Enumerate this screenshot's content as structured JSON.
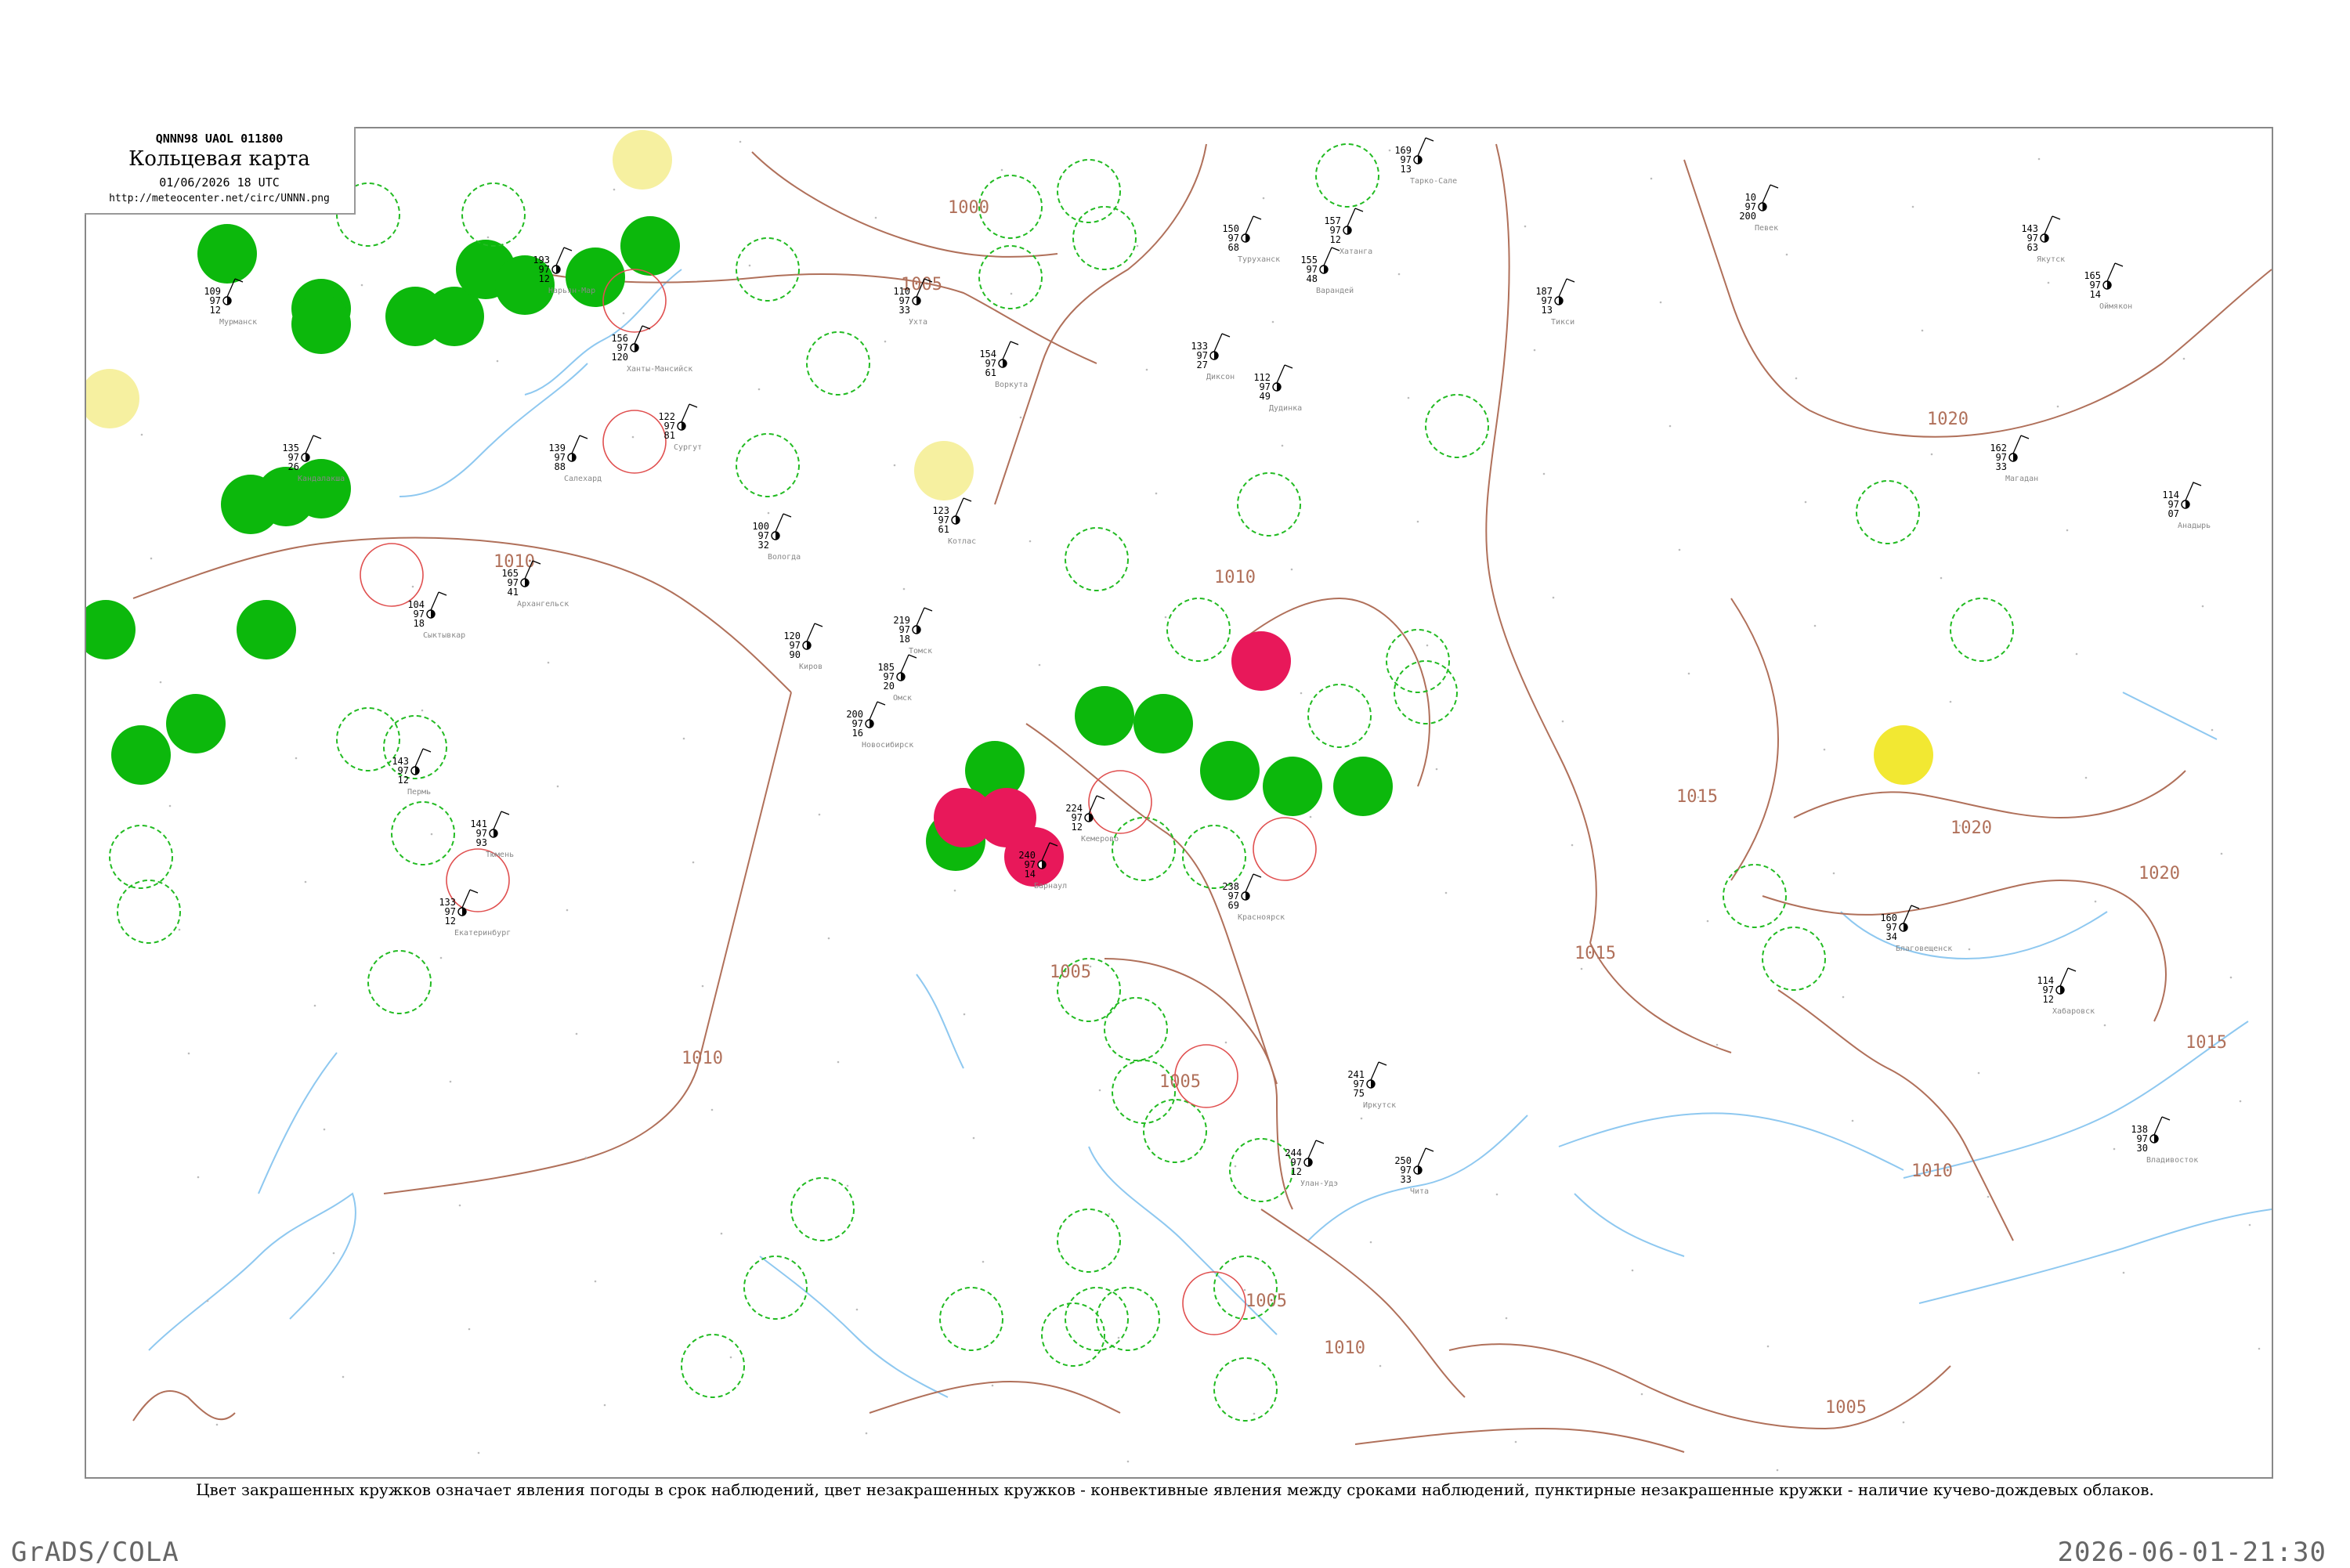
{
  "header": {
    "code": "QNNN98  UAOL  011800",
    "title": "Кольцевая карта",
    "datetime": "01/06/2026 18 UTC",
    "url": "http://meteocenter.net/circ/UNNN.png"
  },
  "legend_caption": "Цвет закрашенных кружков означает явления погоды в срок наблюдений, цвет незакрашенных кружков - конвективные явления между сроками наблюдений, пунктирные незакрашенные кружки - наличие кучево-дождевых облаков.",
  "footer": {
    "left": "GrADS/COLA",
    "right": "2026-06-01-21:30"
  },
  "colors": {
    "isobar": "#b0705a",
    "river": "#8ec8f0",
    "filled_green": "#0cb80c",
    "filled_red": "#e8185a",
    "filled_yellow": "#f2e832",
    "filled_pale_yellow": "#f6f0a0",
    "dashed_ring": "#22bb22",
    "thunder_ring": "#e05050"
  },
  "isobars": [
    "1000",
    "1005",
    "1005",
    "1010",
    "1010",
    "1010",
    "1015",
    "1015",
    "1015",
    "1020",
    "1020",
    "1020",
    "1005",
    "1010",
    "1005",
    "1010",
    "1005"
  ],
  "stations": [
    {
      "name": "Варандей",
      "p": "155",
      "t": "97",
      "d": "48"
    },
    {
      "name": "Тарко-Сале",
      "p": "169",
      "t": "97",
      "d": "13"
    },
    {
      "name": "Мурманск",
      "p": "109",
      "t": "97",
      "d": "12"
    },
    {
      "name": "Кандалакша",
      "p": "135",
      "t": "97",
      "d": "26"
    },
    {
      "name": "Архангельск",
      "p": "165",
      "t": "97",
      "d": "41"
    },
    {
      "name": "Нарьян-Мар",
      "p": "193",
      "t": "97",
      "d": "12"
    },
    {
      "name": "Сыктывкар",
      "p": "104",
      "t": "97",
      "d": "18"
    },
    {
      "name": "Ханты-Мансийск",
      "p": "156",
      "t": "97",
      "d": "120"
    },
    {
      "name": "Салехард",
      "p": "139",
      "t": "97",
      "d": "88"
    },
    {
      "name": "Сургут",
      "p": "122",
      "t": "97",
      "d": "81"
    },
    {
      "name": "Пермь",
      "p": "143",
      "t": "97",
      "d": "12"
    },
    {
      "name": "Екатеринбург",
      "p": "133",
      "t": "97",
      "d": "12"
    },
    {
      "name": "Тюмень",
      "p": "141",
      "t": "97",
      "d": "93"
    },
    {
      "name": "Омск",
      "p": "185",
      "t": "97",
      "d": "20"
    },
    {
      "name": "Новосибирск",
      "p": "200",
      "t": "97",
      "d": "16"
    },
    {
      "name": "Томск",
      "p": "219",
      "t": "97",
      "d": "18"
    },
    {
      "name": "Барнаул",
      "p": "240",
      "t": "97",
      "d": "14"
    },
    {
      "name": "Красноярск",
      "p": "238",
      "t": "97",
      "d": "69"
    },
    {
      "name": "Кемерово",
      "p": "224",
      "t": "97",
      "d": "12"
    },
    {
      "name": "Иркутск",
      "p": "241",
      "t": "97",
      "d": "75"
    },
    {
      "name": "Улан-Удэ",
      "p": "244",
      "t": "97",
      "d": "12"
    },
    {
      "name": "Чита",
      "p": "250",
      "t": "97",
      "d": "33"
    },
    {
      "name": "Якутск",
      "p": "143",
      "t": "97",
      "d": "63"
    },
    {
      "name": "Оймякон",
      "p": "165",
      "t": "97",
      "d": "14"
    },
    {
      "name": "Магадан",
      "p": "162",
      "t": "97",
      "d": "33"
    },
    {
      "name": "Благовещенск",
      "p": "160",
      "t": "97",
      "d": "34"
    },
    {
      "name": "Хабаровск",
      "p": "114",
      "t": "97",
      "d": "12"
    },
    {
      "name": "Владивосток",
      "p": "138",
      "t": "97",
      "d": "30"
    },
    {
      "name": "Анадырь",
      "p": "114",
      "t": "97",
      "d": "07"
    },
    {
      "name": "Певек",
      "p": "10",
      "t": "97",
      "d": "200"
    },
    {
      "name": "Тикси",
      "p": "187",
      "t": "97",
      "d": "13"
    },
    {
      "name": "Хатанга",
      "p": "157",
      "t": "97",
      "d": "12"
    },
    {
      "name": "Диксон",
      "p": "133",
      "t": "97",
      "d": "27"
    },
    {
      "name": "Дудинка",
      "p": "112",
      "t": "97",
      "d": "49"
    },
    {
      "name": "Туруханск",
      "p": "150",
      "t": "97",
      "d": "68"
    },
    {
      "name": "Воркута",
      "p": "154",
      "t": "97",
      "d": "61"
    },
    {
      "name": "Ухта",
      "p": "110",
      "t": "97",
      "d": "33"
    },
    {
      "name": "Котлас",
      "p": "123",
      "t": "97",
      "d": "61"
    },
    {
      "name": "Вологда",
      "p": "100",
      "t": "97",
      "d": "32"
    },
    {
      "name": "Киров",
      "p": "120",
      "t": "97",
      "d": "90"
    }
  ],
  "circles": [
    {
      "color": "green",
      "kind": "filled"
    },
    {
      "color": "red",
      "kind": "filled"
    },
    {
      "color": "yellow",
      "kind": "filled"
    },
    {
      "color": "pale-yellow",
      "kind": "filled"
    },
    {
      "color": "green",
      "kind": "dashed"
    },
    {
      "color": "red",
      "kind": "thin"
    }
  ]
}
